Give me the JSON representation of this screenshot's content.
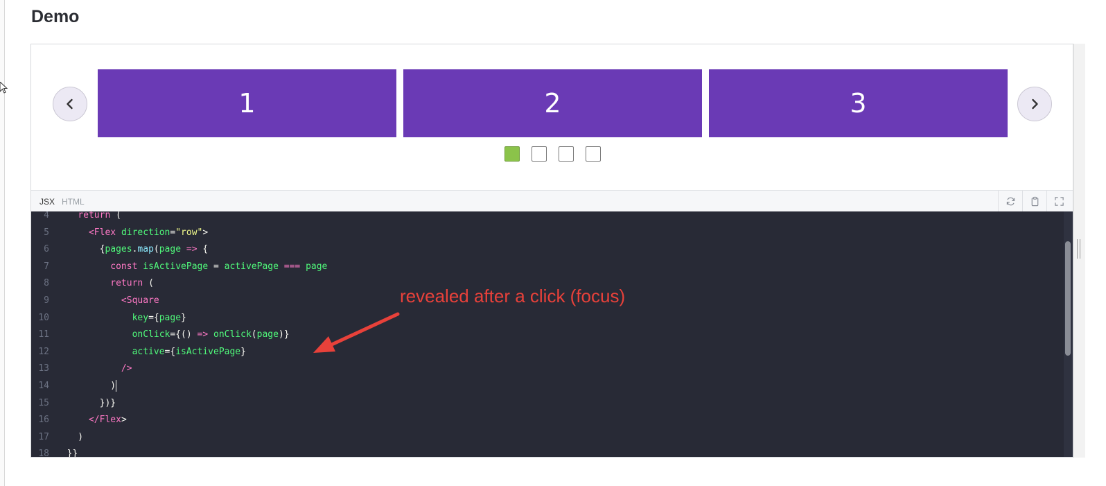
{
  "page": {
    "title": "Demo"
  },
  "carousel": {
    "prev_label": "‹",
    "next_label": "›",
    "slides": [
      "1",
      "2",
      "3"
    ],
    "dots": [
      {
        "active": true
      },
      {
        "active": false
      },
      {
        "active": false
      },
      {
        "active": false
      }
    ],
    "active_color": "#8bc34a",
    "slide_color": "#6a3ab5"
  },
  "code_panel": {
    "tabs": [
      "JSX",
      "HTML"
    ],
    "active_tab": "JSX",
    "tools": [
      "refresh-icon",
      "clipboard-icon",
      "expand-icon"
    ],
    "lines": [
      {
        "n": "4",
        "code": "    return ("
      },
      {
        "n": "5",
        "code": "      <Flex direction=\"row\">"
      },
      {
        "n": "6",
        "code": "        {pages.map(page => {"
      },
      {
        "n": "7",
        "code": "          const isActivePage = activePage === page"
      },
      {
        "n": "8",
        "code": "          return ("
      },
      {
        "n": "9",
        "code": "            <Square"
      },
      {
        "n": "10",
        "code": "              key={page}"
      },
      {
        "n": "11",
        "code": "              onClick={() => onClick(page)}"
      },
      {
        "n": "12",
        "code": "              active={isActivePage}"
      },
      {
        "n": "13",
        "code": "            />"
      },
      {
        "n": "14",
        "code": "          )"
      },
      {
        "n": "15",
        "code": "        })}"
      },
      {
        "n": "16",
        "code": "      </Flex>"
      },
      {
        "n": "17",
        "code": "    )"
      },
      {
        "n": "18",
        "code": "  }}"
      }
    ]
  },
  "annotation": {
    "text": "revealed after a click (focus)",
    "color": "#e8413a"
  }
}
